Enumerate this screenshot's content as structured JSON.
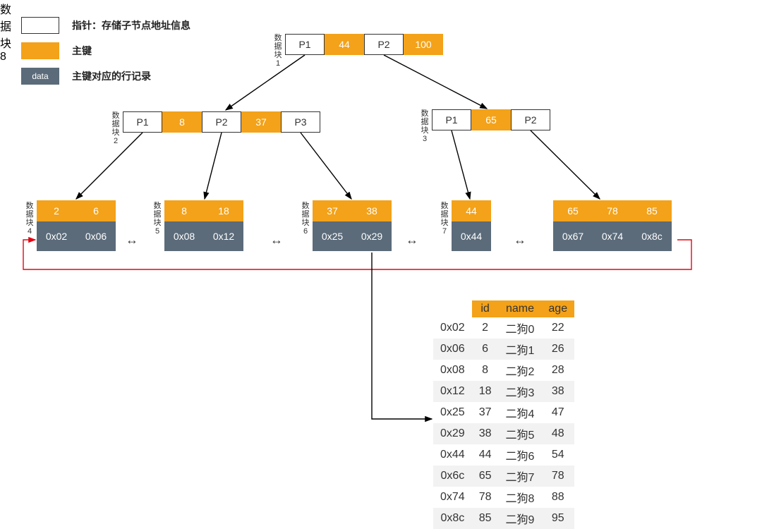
{
  "legend": {
    "pointer": "指针：存储子节点地址信息",
    "key": "主键",
    "data_label": "data",
    "data": "主键对应的行记录"
  },
  "block_label_prefix": "数据块",
  "root": {
    "p1": "P1",
    "k1": "44",
    "p2": "P2",
    "k2": "100"
  },
  "internal": {
    "left": {
      "p1": "P1",
      "k1": "8",
      "p2": "P2",
      "k2": "37",
      "p3": "P3"
    },
    "right": {
      "p1": "P1",
      "k1": "65",
      "p2": "P2"
    }
  },
  "leaves": [
    {
      "keys": [
        "2",
        "6"
      ],
      "data": [
        "0x02",
        "0x06"
      ]
    },
    {
      "keys": [
        "8",
        "18"
      ],
      "data": [
        "0x08",
        "0x12"
      ]
    },
    {
      "keys": [
        "37",
        "38"
      ],
      "data": [
        "0x25",
        "0x29"
      ]
    },
    {
      "keys": [
        "44"
      ],
      "data": [
        "0x44"
      ]
    },
    {
      "keys": [
        "65",
        "78",
        "85"
      ],
      "data": [
        "0x67",
        "0x74",
        "0x8c"
      ]
    }
  ],
  "table": {
    "headers": [
      "id",
      "name",
      "age"
    ],
    "rows": [
      {
        "addr": "0x02",
        "id": "2",
        "name": "二狗0",
        "age": "22"
      },
      {
        "addr": "0x06",
        "id": "6",
        "name": "二狗1",
        "age": "26"
      },
      {
        "addr": "0x08",
        "id": "8",
        "name": "二狗2",
        "age": "28"
      },
      {
        "addr": "0x12",
        "id": "18",
        "name": "二狗3",
        "age": "38"
      },
      {
        "addr": "0x25",
        "id": "37",
        "name": "二狗4",
        "age": "47"
      },
      {
        "addr": "0x29",
        "id": "38",
        "name": "二狗5",
        "age": "48"
      },
      {
        "addr": "0x44",
        "id": "44",
        "name": "二狗6",
        "age": "54"
      },
      {
        "addr": "0x6c",
        "id": "65",
        "name": "二狗7",
        "age": "78"
      },
      {
        "addr": "0x74",
        "id": "78",
        "name": "二狗8",
        "age": "88"
      },
      {
        "addr": "0x8c",
        "id": "85",
        "name": "二狗9",
        "age": "95"
      }
    ]
  }
}
